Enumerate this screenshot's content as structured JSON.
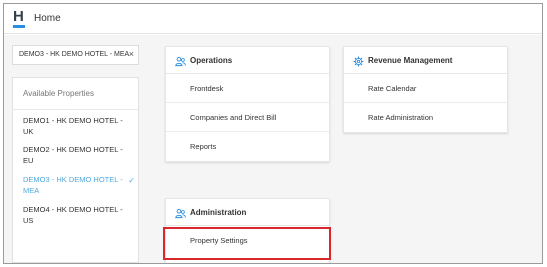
{
  "header": {
    "logo_letter": "H",
    "title": "Home"
  },
  "property_selector": {
    "value": "DEMO3 - HK DEMO HOTEL - MEA",
    "clear_symbol": "×"
  },
  "available_properties": {
    "heading": "Available Properties",
    "items": [
      {
        "label": "DEMO1 - HK DEMO HOTEL - UK"
      },
      {
        "label": "DEMO2 - HK DEMO HOTEL - EU"
      },
      {
        "label": "DEMO3 - HK DEMO HOTEL - MEA",
        "selected": true
      },
      {
        "label": "DEMO4 - HK DEMO HOTEL - US"
      }
    ],
    "check_symbol": "✓"
  },
  "operations": {
    "title": "Operations",
    "icon": "users-icon",
    "items": [
      "Frontdesk",
      "Companies and Direct Bill",
      "Reports"
    ]
  },
  "revenue_management": {
    "title": "Revenue Management",
    "icon": "gear-icon",
    "items": [
      "Rate Calendar",
      "Rate Administration"
    ]
  },
  "administration": {
    "title": "Administration",
    "icon": "users-icon",
    "items": [
      "Property Settings"
    ]
  },
  "colors": {
    "accent": "#51a9df",
    "highlight": "#d9272e",
    "logo_bar": "#2a8ee0"
  }
}
